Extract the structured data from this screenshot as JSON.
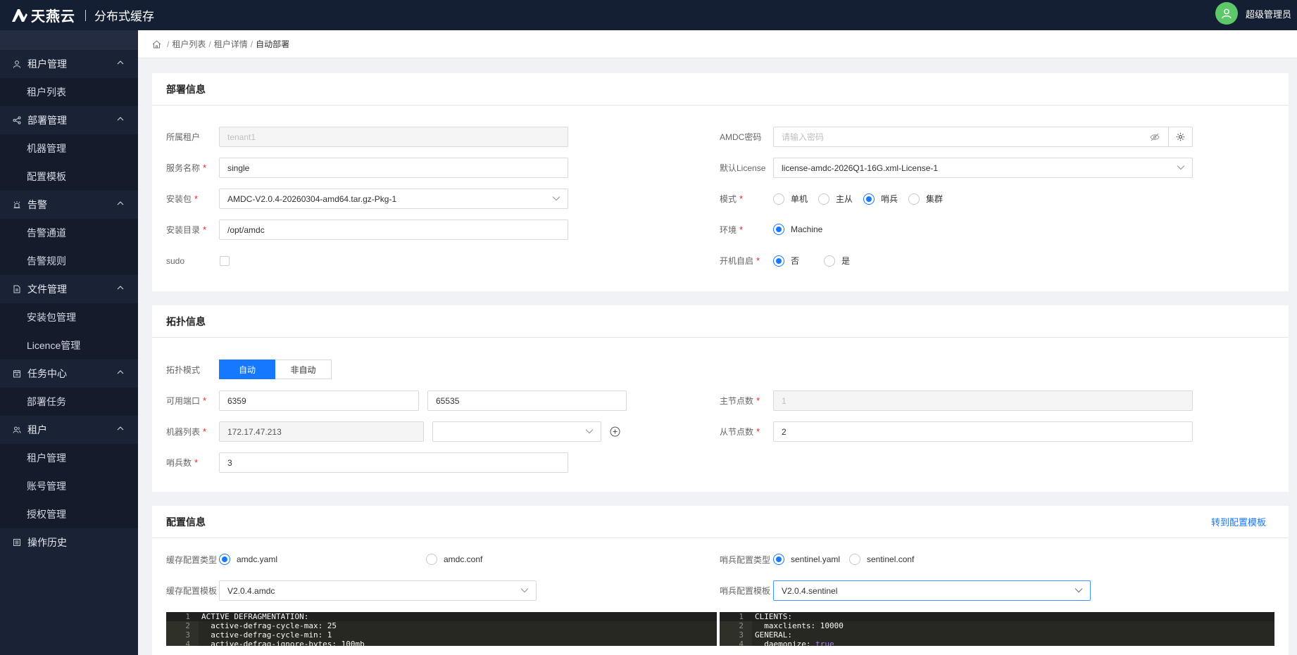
{
  "topbar": {
    "logo_text": "天燕云",
    "app_title": "分布式缓存",
    "user_name": "超级管理员"
  },
  "sidebar": {
    "groups": [
      {
        "label": "租户管理",
        "icon": "user-icon",
        "items": [
          "租户列表"
        ]
      },
      {
        "label": "部署管理",
        "icon": "share-icon",
        "items": [
          "机器管理",
          "配置模板"
        ]
      },
      {
        "label": "告警",
        "icon": "alarm-icon",
        "items": [
          "告警通道",
          "告警规则"
        ]
      },
      {
        "label": "文件管理",
        "icon": "file-icon",
        "items": [
          "安装包管理",
          "Licence管理"
        ]
      },
      {
        "label": "任务中心",
        "icon": "calendar-icon",
        "items": [
          "部署任务"
        ]
      },
      {
        "label": "租户",
        "icon": "users-icon",
        "items": [
          "租户管理",
          "账号管理",
          "授权管理"
        ]
      },
      {
        "label": "操作历史",
        "icon": "history-icon",
        "items": []
      }
    ]
  },
  "breadcrumb": {
    "items": [
      "租户列表",
      "租户详情",
      "自动部署"
    ]
  },
  "deploy": {
    "title": "部署信息",
    "tenant_label": "所属租户",
    "tenant_value": "tenant1",
    "service_label": "服务名称",
    "service_value": "single",
    "package_label": "安装包",
    "package_value": "AMDC-V2.0.4-20260304-amd64.tar.gz-Pkg-1",
    "dir_label": "安装目录",
    "dir_value": "/opt/amdc",
    "sudo_label": "sudo",
    "password_label": "AMDC密码",
    "password_placeholder": "请输入密码",
    "license_label": "默认License",
    "license_value": "license-amdc-2026Q1-16G.xml-License-1",
    "mode_label": "模式",
    "mode_options": [
      "单机",
      "主从",
      "哨兵",
      "集群"
    ],
    "mode_selected": "哨兵",
    "env_label": "环境",
    "env_options": [
      "Machine"
    ],
    "autostart_label": "开机自启",
    "autostart_options": [
      "否",
      "是"
    ],
    "autostart_selected": "否"
  },
  "topology": {
    "title": "拓扑信息",
    "mode_label": "拓扑模式",
    "mode_options": [
      "自动",
      "非自动"
    ],
    "mode_selected": "自动",
    "ports_label": "可用端口",
    "port_min": "6359",
    "port_max": "65535",
    "machines_label": "机器列表",
    "machine_value": "172.17.47.213",
    "sentinel_label": "哨兵数",
    "sentinel_value": "3",
    "master_label": "主节点数",
    "master_value": "1",
    "slave_label": "从节点数",
    "slave_value": "2"
  },
  "config": {
    "title": "配置信息",
    "goto_template": "转到配置模板",
    "cache_type_label": "缓存配置类型",
    "cache_type_options": [
      "amdc.yaml",
      "amdc.conf"
    ],
    "cache_template_label": "缓存配置模板",
    "cache_template_value": "V2.0.4.amdc",
    "sentinel_type_label": "哨兵配置类型",
    "sentinel_type_options": [
      "sentinel.yaml",
      "sentinel.conf"
    ],
    "sentinel_template_label": "哨兵配置模板",
    "sentinel_template_value": "V2.0.4.sentinel",
    "cache_code": [
      {
        "n": "1",
        "key": "ACTIVE DEFRAGMENTATION:",
        "val": ""
      },
      {
        "n": "2",
        "key": "  active-defrag-cycle-max:",
        "val": " 25"
      },
      {
        "n": "3",
        "key": "  active-defrag-cycle-min:",
        "val": " 1"
      },
      {
        "n": "4",
        "key": "  active-defrag-ignore-bytes:",
        "val": " 100mb"
      }
    ],
    "sentinel_code": [
      {
        "n": "1",
        "key": "CLIENTS:",
        "val": ""
      },
      {
        "n": "2",
        "key": "  maxclients:",
        "val": " 10000"
      },
      {
        "n": "3",
        "key": "GENERAL:",
        "val": ""
      },
      {
        "n": "4",
        "key": "  daemonize:",
        "val": " true"
      }
    ]
  },
  "colors": {
    "primary": "#1677ff",
    "sidebar_bg": "#1a2235",
    "topbar_bg": "#141f33",
    "required": "#f5222d"
  }
}
